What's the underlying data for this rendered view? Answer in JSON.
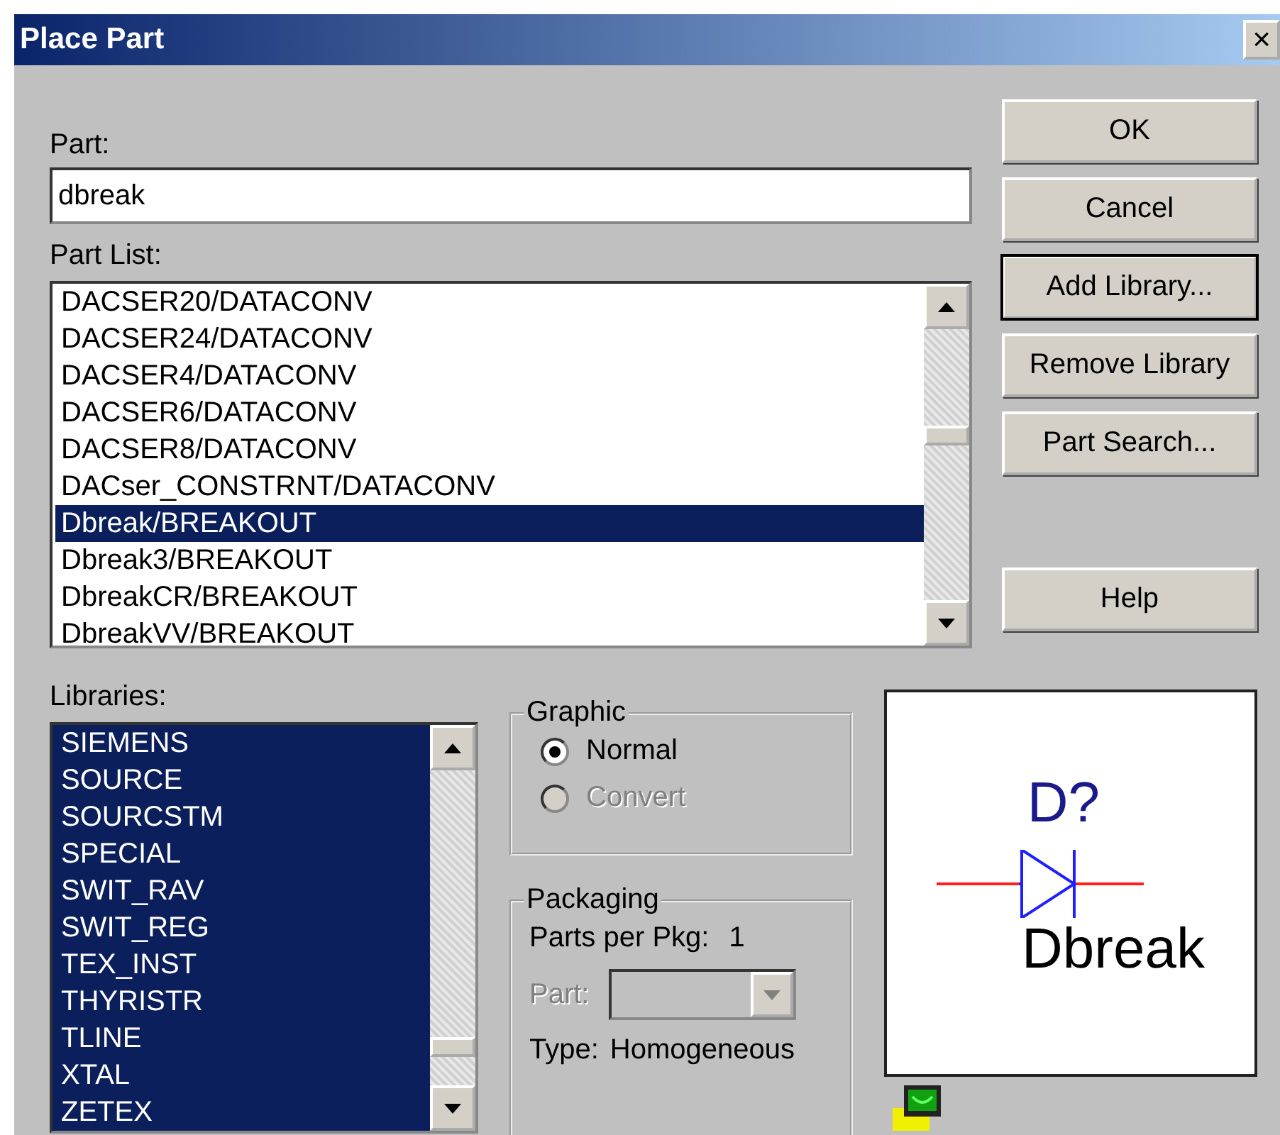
{
  "window": {
    "title": "Place Part",
    "close": "×"
  },
  "part": {
    "label": "Part:",
    "value": "dbreak"
  },
  "part_list": {
    "label": "Part List:",
    "items": [
      {
        "text": "DACSER20/DATACONV",
        "selected": false
      },
      {
        "text": "DACSER24/DATACONV",
        "selected": false
      },
      {
        "text": "DACSER4/DATACONV",
        "selected": false
      },
      {
        "text": "DACSER6/DATACONV",
        "selected": false
      },
      {
        "text": "DACSER8/DATACONV",
        "selected": false
      },
      {
        "text": "DACser_CONSTRNT/DATACONV",
        "selected": false
      },
      {
        "text": "Dbreak/BREAKOUT",
        "selected": true
      },
      {
        "text": "Dbreak3/BREAKOUT",
        "selected": false
      },
      {
        "text": "DbreakCR/BREAKOUT",
        "selected": false
      },
      {
        "text": "DbreakVV/BREAKOUT",
        "selected": false
      }
    ]
  },
  "buttons": [
    {
      "label": "OK",
      "focused": false
    },
    {
      "label": "Cancel",
      "focused": false
    },
    {
      "label": "Add Library...",
      "focused": true
    },
    {
      "label": "Remove Library",
      "focused": false
    },
    {
      "label": "Part Search...",
      "focused": false
    },
    {
      "label": "Help",
      "focused": false
    }
  ],
  "libraries": {
    "label": "Libraries:",
    "items": [
      {
        "text": "SIEMENS",
        "selected": true
      },
      {
        "text": "SOURCE",
        "selected": true
      },
      {
        "text": "SOURCSTM",
        "selected": true
      },
      {
        "text": "SPECIAL",
        "selected": true
      },
      {
        "text": "SWIT_RAV",
        "selected": true
      },
      {
        "text": "SWIT_REG",
        "selected": true
      },
      {
        "text": "TEX_INST",
        "selected": true
      },
      {
        "text": "THYRISTR",
        "selected": true
      },
      {
        "text": "TLINE",
        "selected": true
      },
      {
        "text": "XTAL",
        "selected": true
      },
      {
        "text": "ZETEX",
        "selected": true
      }
    ]
  },
  "graphic": {
    "title": "Graphic",
    "options": [
      {
        "label": "Normal",
        "selected": true,
        "disabled": false
      },
      {
        "label": "Convert",
        "selected": false,
        "disabled": true
      }
    ]
  },
  "packaging": {
    "title": "Packaging",
    "parts_per_pkg_label": "Parts per Pkg:",
    "parts_per_pkg": "1",
    "part_label": "Part:",
    "part_disabled": true,
    "type_label": "Type:",
    "type": "Homogeneous"
  },
  "preview": {
    "reference": "D?",
    "name": "Dbreak"
  }
}
